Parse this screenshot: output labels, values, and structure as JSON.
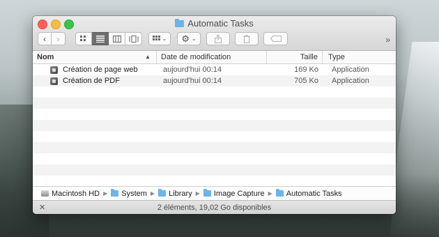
{
  "window": {
    "title": "Automatic Tasks"
  },
  "toolbar": {
    "back_icon": "chevron-left",
    "forward_icon": "chevron-right",
    "view_modes": [
      "icon-view",
      "list-view",
      "column-view",
      "cover-flow-view"
    ],
    "active_view": "list-view",
    "arrange_icon": "grid",
    "action_icon": "gear",
    "share_icon": "share",
    "delete_icon": "trash",
    "tag_icon": "tag",
    "overflow": "»"
  },
  "columns": {
    "name": "Nom",
    "date": "Date de modification",
    "size": "Taille",
    "type": "Type"
  },
  "files": [
    {
      "name": "Création de page web",
      "date": "aujourd'hui 00:14",
      "size": "169 Ko",
      "type": "Application"
    },
    {
      "name": "Création de PDF",
      "date": "aujourd'hui 00:14",
      "size": "705 Ko",
      "type": "Application"
    }
  ],
  "path": [
    {
      "label": "Macintosh HD",
      "icon": "hard-drive"
    },
    {
      "label": "System",
      "icon": "folder"
    },
    {
      "label": "Library",
      "icon": "folder"
    },
    {
      "label": "Image Capture",
      "icon": "folder"
    },
    {
      "label": "Automatic Tasks",
      "icon": "folder"
    }
  ],
  "status": {
    "text": "2 éléments, 19,02 Go disponibles"
  },
  "colors": {
    "close": "#fc605c",
    "minimize": "#fdbc40",
    "zoom": "#34c84a",
    "folder": "#6bb4ee"
  }
}
